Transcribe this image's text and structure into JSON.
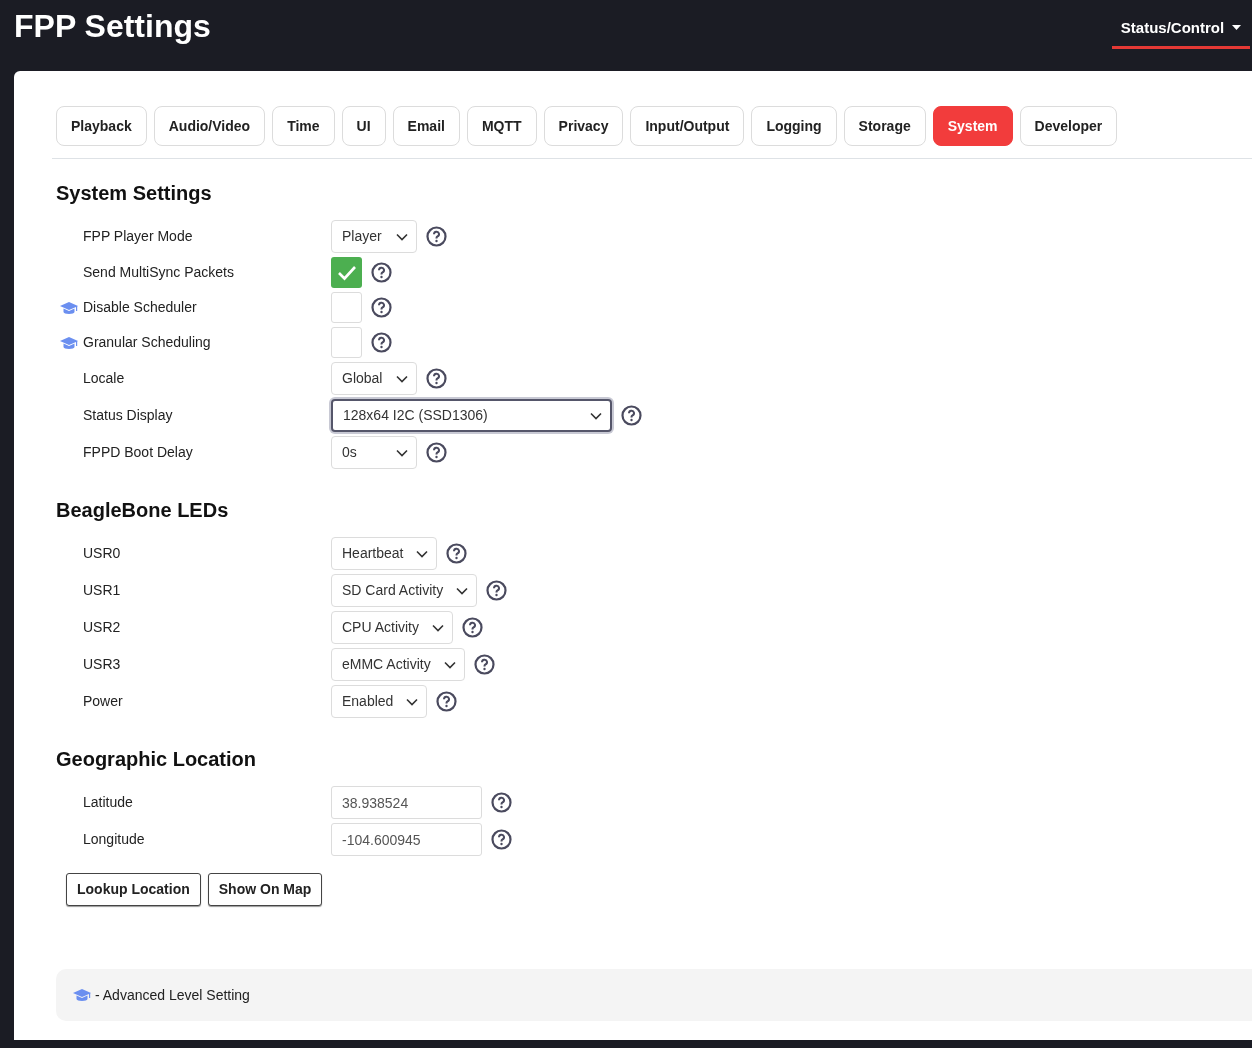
{
  "header": {
    "title": "FPP Settings",
    "menu": {
      "label": "Status/Control",
      "selected": true
    }
  },
  "tabs": [
    {
      "label": "Playback",
      "selected": false
    },
    {
      "label": "Audio/Video",
      "selected": false
    },
    {
      "label": "Time",
      "selected": false
    },
    {
      "label": "UI",
      "selected": false
    },
    {
      "label": "Email",
      "selected": false
    },
    {
      "label": "MQTT",
      "selected": false
    },
    {
      "label": "Privacy",
      "selected": false
    },
    {
      "label": "Input/Output",
      "selected": false
    },
    {
      "label": "Logging",
      "selected": false
    },
    {
      "label": "Storage",
      "selected": false
    },
    {
      "label": "System",
      "selected": true
    },
    {
      "label": "Developer",
      "selected": false
    }
  ],
  "sections": [
    {
      "title": "System Settings",
      "settings": [
        {
          "label": "FPP Player Mode",
          "kind": "select",
          "value": "Player",
          "advanced": false,
          "focused": false
        },
        {
          "label": "Send MultiSync Packets",
          "kind": "checkbox",
          "checked": true,
          "advanced": false
        },
        {
          "label": "Disable Scheduler",
          "kind": "checkbox",
          "checked": false,
          "advanced": true
        },
        {
          "label": "Granular Scheduling",
          "kind": "checkbox",
          "checked": false,
          "advanced": true
        },
        {
          "label": "Locale",
          "kind": "select",
          "value": "Global",
          "advanced": false,
          "focused": false
        },
        {
          "label": "Status Display",
          "kind": "select",
          "value": "128x64 I2C (SSD1306)",
          "advanced": false,
          "focused": true
        },
        {
          "label": "FPPD Boot Delay",
          "kind": "select",
          "value": "0s",
          "advanced": false,
          "focused": false
        }
      ]
    },
    {
      "title": "BeagleBone LEDs",
      "settings": [
        {
          "label": "USR0",
          "kind": "select",
          "value": "Heartbeat",
          "advanced": false,
          "focused": false
        },
        {
          "label": "USR1",
          "kind": "select",
          "value": "SD Card Activity",
          "advanced": false,
          "focused": false
        },
        {
          "label": "USR2",
          "kind": "select",
          "value": "CPU Activity",
          "advanced": false,
          "focused": false
        },
        {
          "label": "USR3",
          "kind": "select",
          "value": "eMMC Activity",
          "advanced": false,
          "focused": false
        },
        {
          "label": "Power",
          "kind": "select",
          "value": "Enabled",
          "advanced": false,
          "focused": false
        }
      ]
    },
    {
      "title": "Geographic Location",
      "settings": [
        {
          "label": "Latitude",
          "kind": "input",
          "value": "38.938524",
          "advanced": false
        },
        {
          "label": "Longitude",
          "kind": "input",
          "value": "-104.600945",
          "advanced": false
        }
      ],
      "buttons": [
        "Lookup Location",
        "Show On Map"
      ]
    }
  ],
  "legend": "- Advanced Level Setting"
}
